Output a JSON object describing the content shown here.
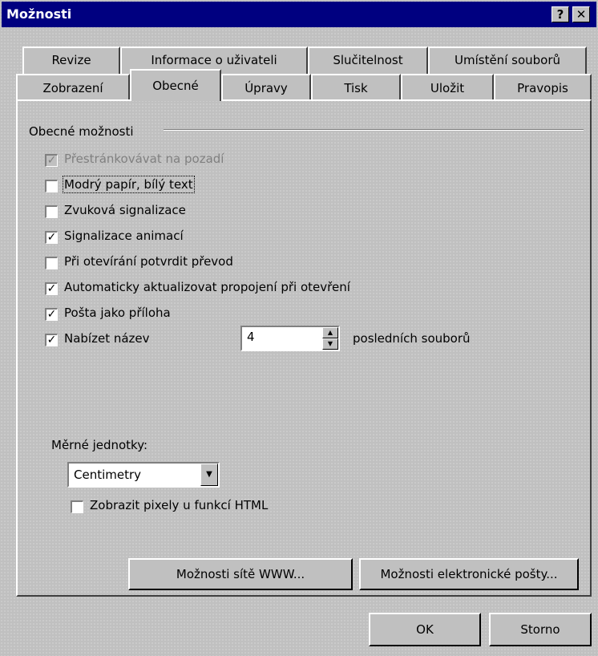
{
  "window": {
    "title": "Možnosti",
    "help_label": "?",
    "close_label": "✕"
  },
  "tabs": {
    "row1": [
      "Revize",
      "Informace o uživateli",
      "Slučitelnost",
      "Umístění souborů"
    ],
    "row2": [
      "Zobrazení",
      "Obecné",
      "Úpravy",
      "Tisk",
      "Uložit",
      "Pravopis"
    ],
    "active": "Obecné"
  },
  "general": {
    "group_label": "Obecné možnosti",
    "options": [
      {
        "label": "Přestránkovávat na pozadí",
        "checked": true,
        "disabled": true
      },
      {
        "label": "Modrý papír, bílý text",
        "checked": false,
        "focused": true
      },
      {
        "label": "Zvuková signalizace",
        "checked": false
      },
      {
        "label": "Signalizace animací",
        "checked": true
      },
      {
        "label": "Při otevírání potvrdit převod",
        "checked": false
      },
      {
        "label": "Automaticky aktualizovat propojení při otevření",
        "checked": true
      },
      {
        "label": "Pošta jako příloha",
        "checked": true
      },
      {
        "label": "Nabízet název",
        "checked": true
      }
    ],
    "recent_files": {
      "value": "4",
      "suffix": "posledních souborů"
    },
    "units": {
      "label": "Měrné jednotky:",
      "value": "Centimetry"
    },
    "pixels_html": {
      "label": "Zobrazit pixely u funkcí HTML",
      "checked": false
    }
  },
  "buttons": {
    "web_options": "Možnosti sítě WWW...",
    "email_options": "Možnosti elektronické pošty...",
    "ok": "OK",
    "cancel": "Storno"
  },
  "colors": {
    "titlebar": "#000080",
    "face": "#c0c0c0"
  }
}
